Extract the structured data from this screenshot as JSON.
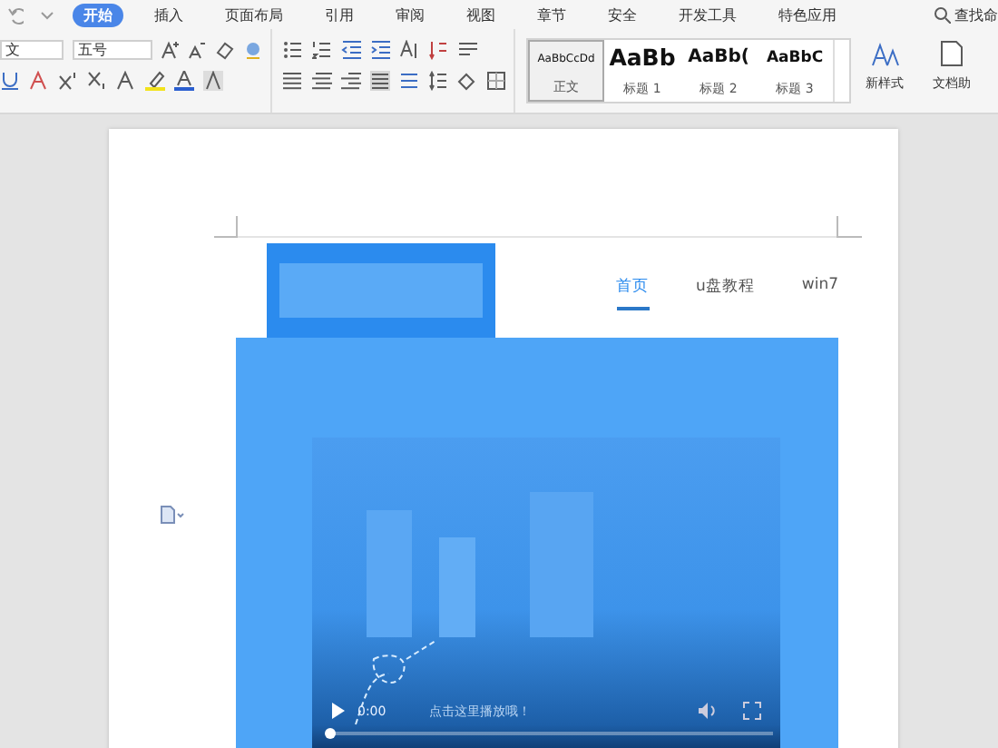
{
  "menu": {
    "tabs": [
      {
        "label": "开始",
        "selected": true
      },
      {
        "label": "插入",
        "selected": false
      },
      {
        "label": "页面布局",
        "selected": false
      },
      {
        "label": "引用",
        "selected": false
      },
      {
        "label": "审阅",
        "selected": false
      },
      {
        "label": "视图",
        "selected": false
      },
      {
        "label": "章节",
        "selected": false
      },
      {
        "label": "安全",
        "selected": false
      },
      {
        "label": "开发工具",
        "selected": false
      },
      {
        "label": "特色应用",
        "selected": false
      }
    ],
    "search": "查找命"
  },
  "ribbon": {
    "font_name": "文",
    "font_size": "五号",
    "styles": [
      {
        "sample": "AaBbCcDd",
        "label": "正文",
        "kind": "body",
        "selected": true
      },
      {
        "sample": "AaBb",
        "label": "标题 1",
        "kind": "heading1",
        "selected": false
      },
      {
        "sample": "AaBb(",
        "label": "标题 2",
        "kind": "heading2",
        "selected": false
      },
      {
        "sample": "AaBbC",
        "label": "标题 3",
        "kind": "heading3",
        "selected": false
      }
    ],
    "new_style": "新样式",
    "assistant": "文档助"
  },
  "document": {
    "embedded_page": {
      "nav": [
        {
          "label": "首页",
          "selected": true
        },
        {
          "label": "u盘教程",
          "selected": false
        },
        {
          "label": "win7",
          "selected": false
        }
      ],
      "video": {
        "time": "0:00",
        "caption": "点击这里播放哦！",
        "level": 0
      }
    }
  }
}
